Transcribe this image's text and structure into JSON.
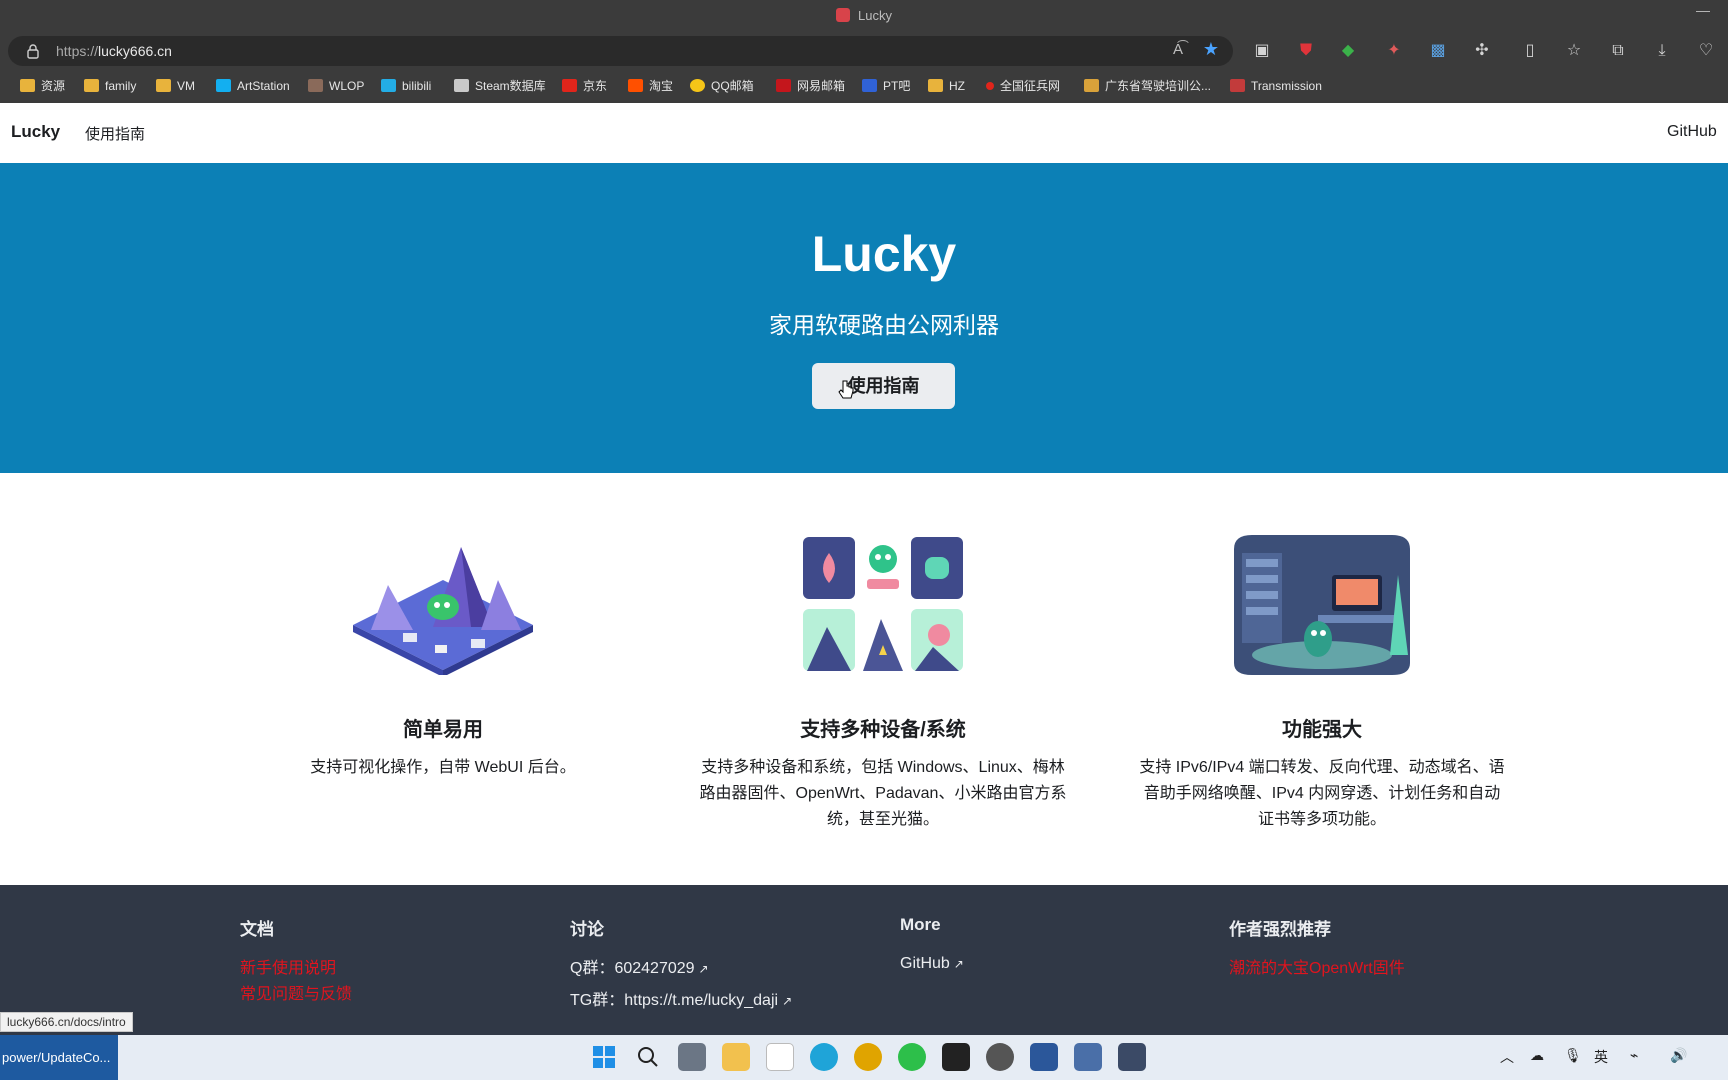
{
  "browser": {
    "window_title": "Lucky",
    "url_scheme": "https://",
    "url_host": "lucky666.cn",
    "bookmarks": [
      {
        "label": "资源",
        "color": "#e8b33c"
      },
      {
        "label": "family",
        "color": "#e8b33c"
      },
      {
        "label": "VM",
        "color": "#e8b33c"
      },
      {
        "label": "ArtStation",
        "color": "#13aff0"
      },
      {
        "label": "WLOP",
        "color": "#8a6a5a"
      },
      {
        "label": "bilibili",
        "color": "#23ade5"
      },
      {
        "label": "Steam数据库",
        "color": "#c9c9c9"
      },
      {
        "label": "京东",
        "color": "#e1251b"
      },
      {
        "label": "淘宝",
        "color": "#ff5000"
      },
      {
        "label": "QQ邮箱",
        "color": "#f5c518"
      },
      {
        "label": "网易邮箱",
        "color": "#c4161c"
      },
      {
        "label": "PT吧",
        "color": "#3062d6"
      },
      {
        "label": "HZ",
        "color": "#e8b33c"
      },
      {
        "label": "全国征兵网",
        "color": "#e1251b"
      },
      {
        "label": "广东省驾驶培训公...",
        "color": "#d9a23a"
      },
      {
        "label": "Transmission",
        "color": "#c23b3b"
      }
    ]
  },
  "site": {
    "brand": "Lucky",
    "nav_docs": "使用指南",
    "nav_github": "GitHub"
  },
  "hero": {
    "title": "Lucky",
    "tagline": "家用软硬路由公网利器",
    "button": "使用指南",
    "bg_color": "#0c80b6"
  },
  "features": [
    {
      "title": "简单易用",
      "desc": "支持可视化操作，自带 WebUI 后台。",
      "image": "isometric-mountain-illustration"
    },
    {
      "title": "支持多种设备/系统",
      "desc": "支持多种设备和系统，包括 Windows、Linux、梅林路由器固件、OpenWrt、Padavan、小米路由官方系统，甚至光猫。",
      "image": "devices-grid-illustration"
    },
    {
      "title": "功能强大",
      "desc": "支持 IPv6/IPv4 端口转发、反向代理、动态域名、语音助手网络唤醒、IPv4 内网穿透、计划任务和自动证书等多项功能。",
      "image": "workshop-room-illustration"
    }
  ],
  "footer": {
    "col1_title": "文档",
    "col1_links": [
      "新手使用说明",
      "常见问题与反馈"
    ],
    "col2_title": "讨论",
    "col2_qq": "Q群：602427029",
    "col2_tg": "TG群：https://t.me/lucky_daji",
    "col3_title": "More",
    "col3_github": "GitHub",
    "col4_title": "作者强烈推荐",
    "col4_link": "潮流的大宝OpenWrt固件"
  },
  "status_url": "lucky666.cn/docs/intro",
  "taskbar": {
    "active_app": "power/UpdateCo...",
    "ime": "英"
  }
}
